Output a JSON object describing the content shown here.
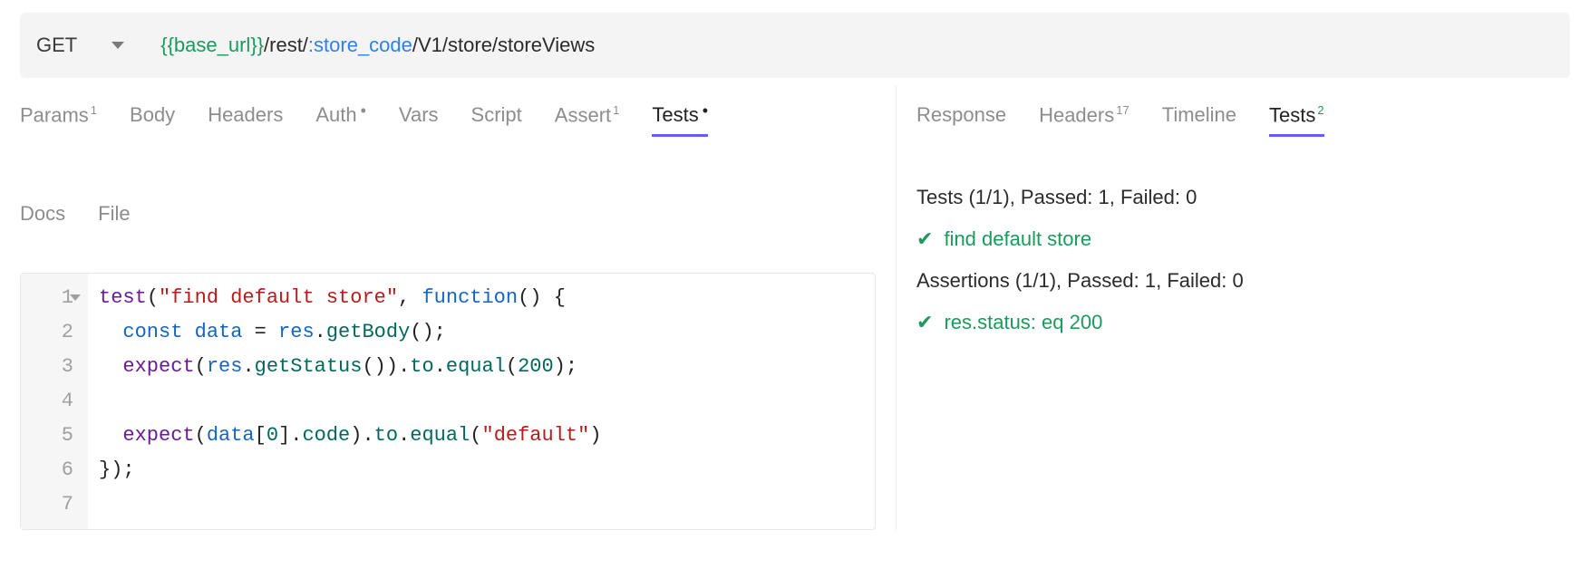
{
  "request": {
    "method": "GET",
    "url_var": "{{base_url}}",
    "url_mid1": "/rest/",
    "url_pathvar": ":store_code",
    "url_tail": "/V1/store/storeViews"
  },
  "leftTabs": {
    "params": "Params",
    "params_sup": "1",
    "body": "Body",
    "headers": "Headers",
    "auth": "Auth",
    "vars": "Vars",
    "script": "Script",
    "assert": "Assert",
    "assert_sup": "1",
    "tests": "Tests",
    "docs": "Docs",
    "file": "File"
  },
  "rightTabs": {
    "response": "Response",
    "headers": "Headers",
    "headers_sup": "17",
    "timeline": "Timeline",
    "tests": "Tests",
    "tests_sup": "2"
  },
  "code": {
    "l1_a": "test",
    "l1_b": "(",
    "l1_c": "\"find default store\"",
    "l1_d": ", ",
    "l1_e": "function",
    "l1_f": "() {",
    "l2_a": "  ",
    "l2_b": "const",
    "l2_c": " ",
    "l2_d": "data",
    "l2_e": " = ",
    "l2_f": "res",
    "l2_g": ".",
    "l2_h": "getBody",
    "l2_i": "();",
    "l3_a": "  ",
    "l3_b": "expect",
    "l3_c": "(",
    "l3_d": "res",
    "l3_e": ".",
    "l3_f": "getStatus",
    "l3_g": "()).",
    "l3_h": "to",
    "l3_i": ".",
    "l3_j": "equal",
    "l3_k": "(",
    "l3_l": "200",
    "l3_m": ");",
    "l4": "",
    "l5_a": "  ",
    "l5_b": "expect",
    "l5_c": "(",
    "l5_d": "data",
    "l5_e": "[",
    "l5_f": "0",
    "l5_g": "].",
    "l5_h": "code",
    "l5_i": ").",
    "l5_j": "to",
    "l5_k": ".",
    "l5_l": "equal",
    "l5_m": "(",
    "l5_n": "\"default\"",
    "l5_o": ")",
    "l6": "});",
    "l7": ""
  },
  "lineNums": [
    "1",
    "2",
    "3",
    "4",
    "5",
    "6",
    "7"
  ],
  "results": {
    "tests_header": "Tests (1/1), Passed: 1, Failed: 0",
    "test1": "find default store",
    "assertions_header": "Assertions (1/1), Passed: 1, Failed: 0",
    "assert1": "res.status: eq 200"
  }
}
